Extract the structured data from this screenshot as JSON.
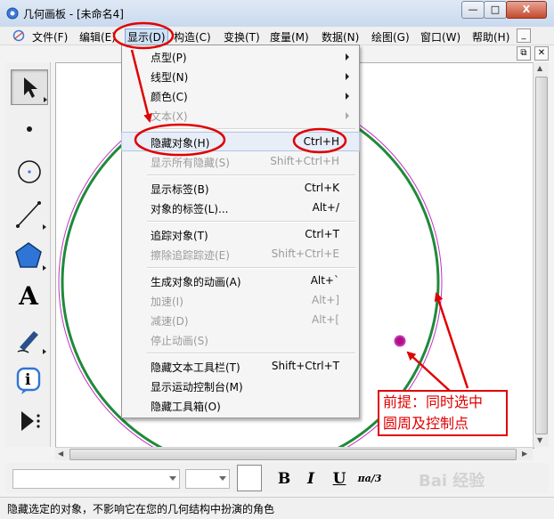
{
  "window": {
    "title": "几何画板 - [未命名4]",
    "minimize_glyph": "—",
    "maximize_glyph": "□",
    "close_glyph": "X"
  },
  "menubar": {
    "items": [
      "文件(F)",
      "编辑(E)",
      "显示(D)",
      "构造(C)",
      "变换(T)",
      "度量(M)",
      "数据(N)",
      "绘图(G)",
      "窗口(W)",
      "帮助(H)"
    ],
    "mdi_minimize": "_",
    "mdi_restore": "⧉",
    "mdi_close": "✕"
  },
  "display_menu": {
    "items": [
      {
        "label": "点型(P)",
        "shortcut": "",
        "submenu": true,
        "enabled": true
      },
      {
        "label": "线型(N)",
        "shortcut": "",
        "submenu": true,
        "enabled": true
      },
      {
        "label": "颜色(C)",
        "shortcut": "",
        "submenu": true,
        "enabled": true
      },
      {
        "label": "文本(X)",
        "shortcut": "",
        "submenu": true,
        "enabled": false
      },
      {
        "label": "隐藏对象(H)",
        "shortcut": "Ctrl+H",
        "submenu": false,
        "enabled": true
      },
      {
        "label": "显示所有隐藏(S)",
        "shortcut": "Shift+Ctrl+H",
        "submenu": false,
        "enabled": false
      },
      {
        "label": "显示标签(B)",
        "shortcut": "Ctrl+K",
        "submenu": false,
        "enabled": true
      },
      {
        "label": "对象的标签(L)...",
        "shortcut": "Alt+/",
        "submenu": false,
        "enabled": true
      },
      {
        "label": "追踪对象(T)",
        "shortcut": "Ctrl+T",
        "submenu": false,
        "enabled": true
      },
      {
        "label": "擦除追踪踪迹(E)",
        "shortcut": "Shift+Ctrl+E",
        "submenu": false,
        "enabled": false
      },
      {
        "label": "生成对象的动画(A)",
        "shortcut": "Alt+`",
        "submenu": false,
        "enabled": true
      },
      {
        "label": "加速(I)",
        "shortcut": "Alt+]",
        "submenu": false,
        "enabled": false
      },
      {
        "label": "减速(D)",
        "shortcut": "Alt+[",
        "submenu": false,
        "enabled": false
      },
      {
        "label": "停止动画(S)",
        "shortcut": "",
        "submenu": false,
        "enabled": false
      },
      {
        "label": "隐藏文本工具栏(T)",
        "shortcut": "Shift+Ctrl+T",
        "submenu": false,
        "enabled": true
      },
      {
        "label": "显示运动控制台(M)",
        "shortcut": "",
        "submenu": false,
        "enabled": true
      },
      {
        "label": "隐藏工具箱(O)",
        "shortcut": "",
        "submenu": false,
        "enabled": true
      }
    ]
  },
  "toolbox": {
    "tools": [
      "arrow-tool",
      "point-tool",
      "compass-tool",
      "straightedge-tool",
      "polygon-tool",
      "text-tool",
      "marker-tool",
      "information-tool",
      "custom-tool"
    ],
    "text_tool_glyph": "A",
    "info_tool_glyph": "i"
  },
  "text_toolbar": {
    "bold": "B",
    "italic": "I",
    "underline": "U",
    "math_label": "πa/3"
  },
  "annotation": {
    "line1": "前提：同时选中",
    "line2": "圆周及控制点"
  },
  "status": {
    "text": "隐藏选定的对象，不影响它在您的几何结构中扮演的角色"
  },
  "watermark": "Bai 经验",
  "colors": {
    "annotation_red": "#e00000",
    "circle_green": "#1f8a3a",
    "circle_magenta": "#c233c2"
  }
}
